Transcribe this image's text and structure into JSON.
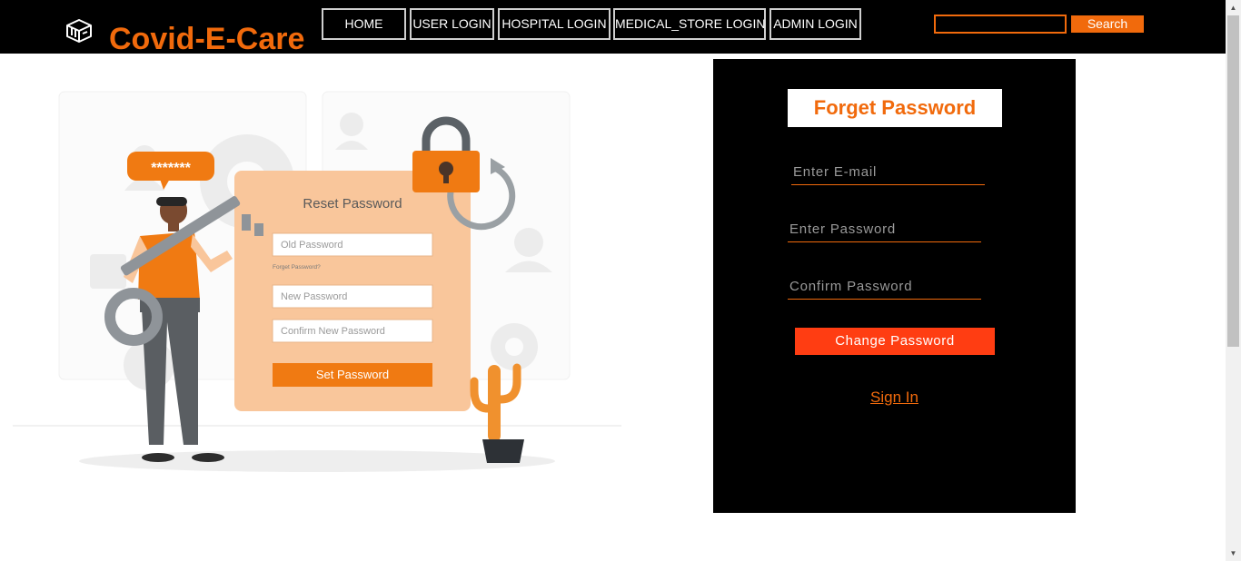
{
  "header": {
    "brand": "Covid-E-Care",
    "logo_icon": "hospital-box-icon",
    "nav": [
      {
        "label": "HOME"
      },
      {
        "label": "USER LOGIN"
      },
      {
        "label": "HOSPITAL LOGIN"
      },
      {
        "label": "MEDICAL_STORE LOGIN"
      },
      {
        "label": "ADMIN LOGIN"
      }
    ],
    "search": {
      "value": "",
      "button_label": "Search"
    }
  },
  "illustration": {
    "bubble_text": "*******",
    "card_title": "Reset Password",
    "old_password": "Old Password",
    "forgot_link": "Forget Password?",
    "new_password": "New Password",
    "confirm_password": "Confirm New Password",
    "button": "Set Password"
  },
  "form": {
    "title": "Forget Password",
    "email_placeholder": "Enter E-mail",
    "password_placeholder": "Enter Password",
    "confirm_placeholder": "Confirm Password",
    "submit_label": "Change Password",
    "signin_label": "Sign In"
  },
  "colors": {
    "accent": "#f16a0c",
    "button_red": "#ff3d12",
    "header_bg": "#000000",
    "panel_bg": "#000000"
  }
}
